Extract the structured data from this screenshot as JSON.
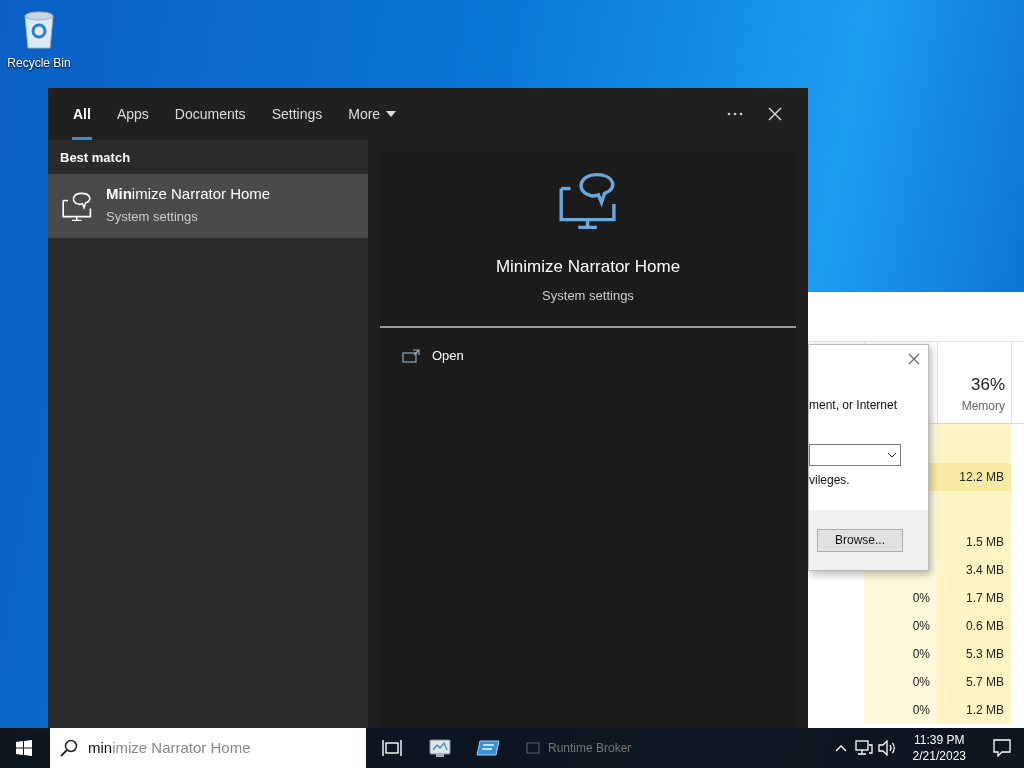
{
  "desktop": {
    "icons": [
      {
        "label": "Recycle Bin"
      }
    ]
  },
  "task_manager": {
    "memory_usage": "36%",
    "memory_column": "Memory",
    "row_groups": [
      {
        "rows": [
          {
            "memory": "12.2 MB",
            "highlighted": true
          }
        ]
      },
      {
        "rows": [
          {
            "memory": "1.5 MB",
            "highlighted": false
          },
          {
            "memory": "3.4 MB",
            "highlighted": false
          },
          {
            "cpu": "0%",
            "memory": "1.7 MB",
            "highlighted": false
          },
          {
            "cpu": "0%",
            "memory": "0.6 MB",
            "highlighted": false
          },
          {
            "cpu": "0%",
            "memory": "5.3 MB",
            "highlighted": false
          },
          {
            "cpu": "0%",
            "memory": "5.7 MB",
            "highlighted": false
          },
          {
            "cpu": "0%",
            "memory": "1.2 MB",
            "highlighted": false
          }
        ]
      }
    ],
    "process_behind_taskbar": "Runtime Broker"
  },
  "run_dialog": {
    "description_line_1": "ment, or Internet",
    "description_line_2": "vileges.",
    "browse_button": "Browse..."
  },
  "search": {
    "tabs": [
      {
        "label": "All",
        "selected": true,
        "kind": "plain"
      },
      {
        "label": "Apps",
        "selected": false,
        "kind": "plain"
      },
      {
        "label": "Documents",
        "selected": false,
        "kind": "plain"
      },
      {
        "label": "Settings",
        "selected": false,
        "kind": "plain"
      },
      {
        "label": "More",
        "selected": false,
        "kind": "dropdown"
      }
    ],
    "best_match_heading": "Best match",
    "results": [
      {
        "title": "**Min**imize Narrator Home",
        "subtitle": "System settings",
        "selected": true
      }
    ],
    "preview": {
      "title": "Minimize Narrator Home",
      "subtitle": "System settings",
      "actions": [
        {
          "label": "Open"
        }
      ]
    }
  },
  "taskbar": {
    "query": "min",
    "suggestion": "imize Narrator Home",
    "clock": {
      "time": "11:39 PM",
      "date": "2/21/2023"
    }
  }
}
